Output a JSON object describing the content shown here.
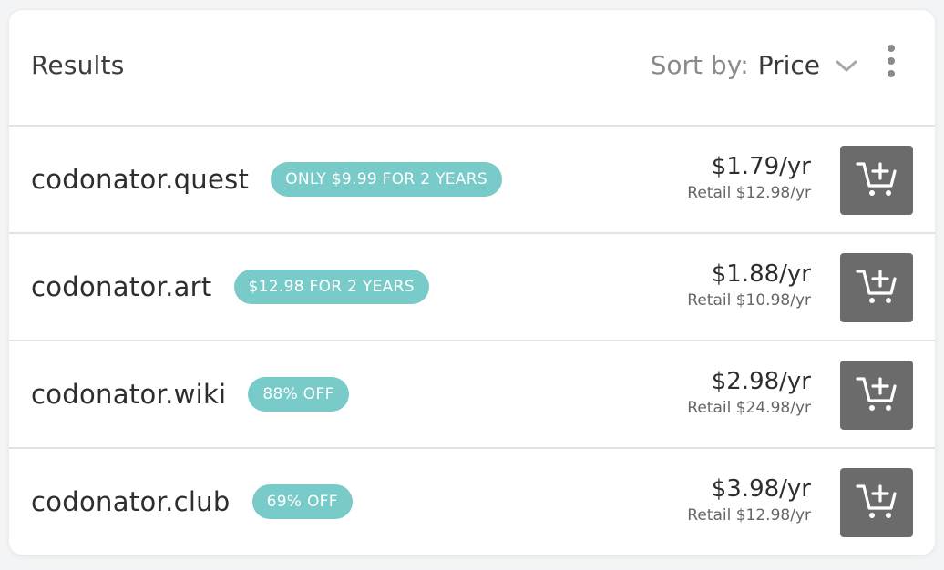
{
  "header": {
    "title": "Results",
    "sort_label": "Sort by:",
    "sort_value": "Price"
  },
  "icons": {
    "sort": "chevron-down-icon",
    "menu": "more-vertical-icon",
    "cart": "add-to-cart-icon"
  },
  "colors": {
    "badge": "#78cbc8",
    "cart_button": "#6b6b6b"
  },
  "results": [
    {
      "domain": "codonator.quest",
      "badge": "ONLY $9.99 FOR 2 YEARS",
      "price": "$1.79/yr",
      "retail": "Retail $12.98/yr"
    },
    {
      "domain": "codonator.art",
      "badge": "$12.98 FOR 2 YEARS",
      "price": "$1.88/yr",
      "retail": "Retail $10.98/yr"
    },
    {
      "domain": "codonator.wiki",
      "badge": "88% OFF",
      "price": "$2.98/yr",
      "retail": "Retail $24.98/yr"
    },
    {
      "domain": "codonator.club",
      "badge": "69% OFF",
      "price": "$3.98/yr",
      "retail": "Retail $12.98/yr"
    }
  ]
}
